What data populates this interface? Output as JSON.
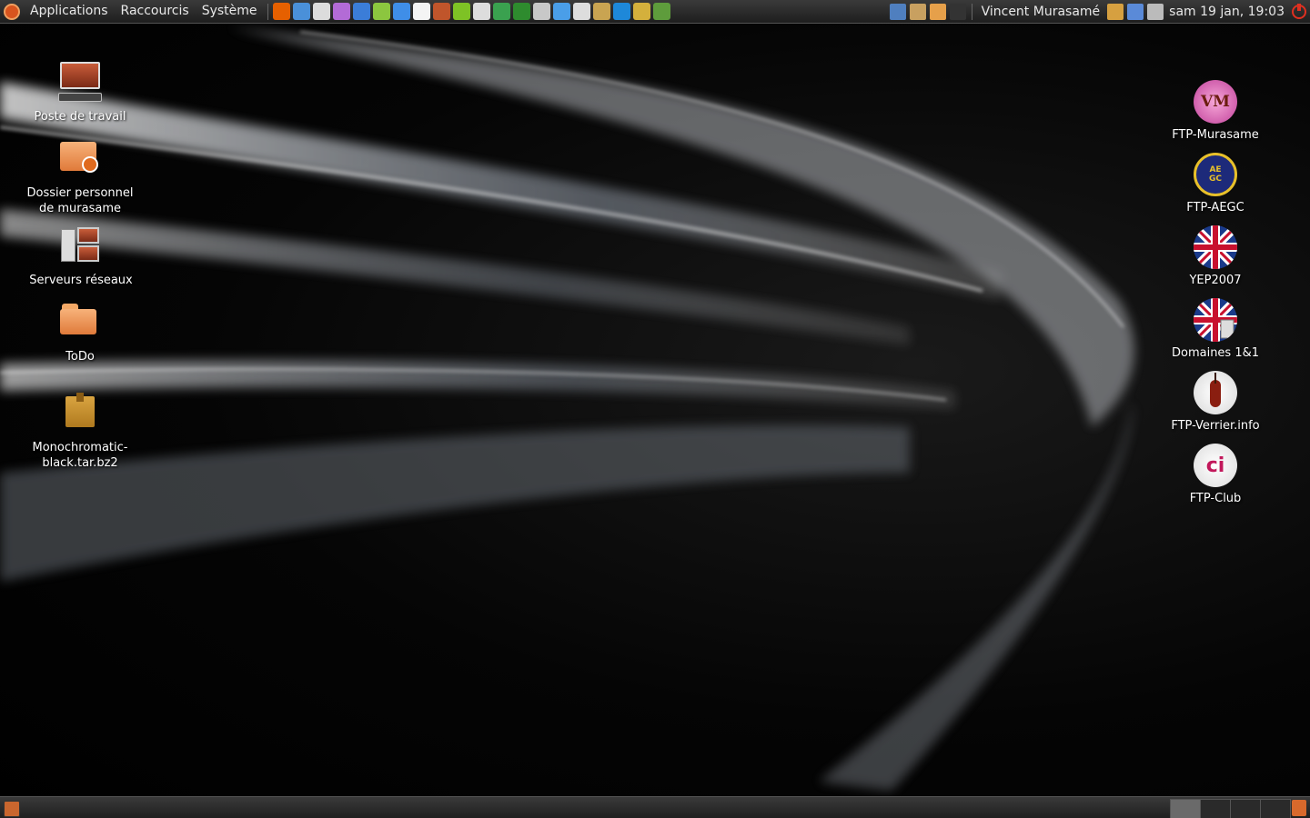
{
  "top_panel": {
    "menus": [
      "Applications",
      "Raccourcis",
      "Système"
    ],
    "launchers": [
      {
        "name": "firefox-icon",
        "color": "#e66000"
      },
      {
        "name": "epiphany-icon",
        "color": "#4a90d9"
      },
      {
        "name": "mail-icon",
        "color": "#dcdcdc"
      },
      {
        "name": "pidgin-icon",
        "color": "#b36bd6"
      },
      {
        "name": "drop-icon",
        "color": "#3b7dd8"
      },
      {
        "name": "clock-app-icon",
        "color": "#8cc63f"
      },
      {
        "name": "disc-icon",
        "color": "#3f8ee8"
      },
      {
        "name": "notes-icon",
        "color": "#f4f4f4"
      },
      {
        "name": "archive-icon",
        "color": "#c0552b"
      },
      {
        "name": "media-player-icon",
        "color": "#7ec225"
      },
      {
        "name": "glasses-icon",
        "color": "#dddddd"
      },
      {
        "name": "cube-icon",
        "color": "#3aa14f"
      },
      {
        "name": "plant-icon",
        "color": "#2e8b2e"
      },
      {
        "name": "gimp-icon",
        "color": "#c8c8c8"
      },
      {
        "name": "water-drop-icon",
        "color": "#4a9ee8"
      },
      {
        "name": "network-icon",
        "color": "#dddddd"
      },
      {
        "name": "harp-icon",
        "color": "#c9a451"
      },
      {
        "name": "writer-icon",
        "color": "#1e88d9"
      },
      {
        "name": "phone-icon",
        "color": "#d4b03c"
      },
      {
        "name": "game-icon",
        "color": "#5e9c3c"
      }
    ],
    "tray_icons": [
      {
        "name": "screenshot-icon",
        "color": "#4f7fbf"
      },
      {
        "name": "settings-icon",
        "color": "#c8a060"
      },
      {
        "name": "folder-icon",
        "color": "#e6a04a"
      },
      {
        "name": "terminal-icon",
        "color": "#333333"
      }
    ],
    "user": "Vincent Murasamé",
    "status_icons": [
      {
        "name": "update-icon",
        "color": "#d6a040"
      },
      {
        "name": "signal-icon",
        "color": "#5a8ad8"
      },
      {
        "name": "volume-icon",
        "color": "#bbbbbb"
      }
    ],
    "clock": "sam 19 jan, 19:03",
    "power_color": "#e03020"
  },
  "desktop_left": [
    {
      "name": "computer",
      "label": "Poste de travail",
      "icon": "computer-icon"
    },
    {
      "name": "home-folder",
      "label": "Dossier personnel de murasame",
      "icon": "home-folder-icon"
    },
    {
      "name": "network-servers",
      "label": "Serveurs réseaux",
      "icon": "network-servers-icon"
    },
    {
      "name": "todo-folder",
      "label": "ToDo",
      "icon": "folder-icon"
    },
    {
      "name": "archive-file",
      "label": "Monochromatic-black.tar.bz2",
      "icon": "archive-icon"
    }
  ],
  "desktop_right": [
    {
      "name": "ftp-murasame",
      "label": "FTP-Murasame",
      "icon": "vm-icon",
      "badge": "VM"
    },
    {
      "name": "ftp-aegc",
      "label": "FTP-AEGC",
      "icon": "aegc-icon",
      "badge": "AE GC"
    },
    {
      "name": "yep2007",
      "label": "YEP2007",
      "icon": "uk-flag-icon"
    },
    {
      "name": "domaines-1and1",
      "label": "Domaines 1&1",
      "icon": "uk-flag-cabinet-icon"
    },
    {
      "name": "ftp-verrier",
      "label": "FTP-Verrier.info",
      "icon": "violin-icon"
    },
    {
      "name": "ftp-club",
      "label": "FTP-Club",
      "icon": "ci-icon",
      "badge": "ci"
    }
  ],
  "bottom_panel": {
    "workspaces": 4,
    "active_workspace": 1
  }
}
